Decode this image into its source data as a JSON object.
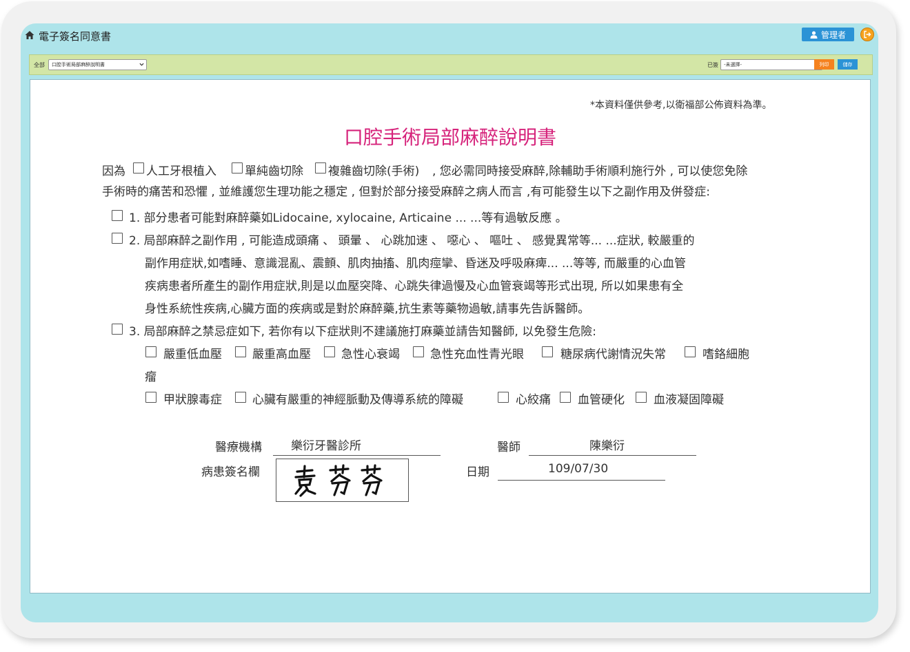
{
  "app": {
    "title": "電子簽名同意書",
    "admin_label": "管理者"
  },
  "toolbar": {
    "category_label": "全部",
    "category_value": "口腔手術局部麻醉說明書",
    "signed_label": "已簽",
    "signed_value": "-未選擇-",
    "print_label": "列印",
    "save_label": "儲存"
  },
  "document": {
    "disclaimer": "*本資料僅供參考,以衛福部公佈資料為準。",
    "title": "口腔手術局部麻醉說明書",
    "intro": {
      "prefix": "因為",
      "options": [
        "人工牙根植入",
        "單純齒切除",
        "複雜齒切除(手術)"
      ],
      "line1_rest": ", 您必需同時接受麻醉,除輔助手術順利施行外 , 可以使您免除",
      "line2": "手術時的痛苦和恐懼 , 並維護您生理功能之穩定 , 但對於部分接受麻醉之病人而言 ,有可能發生以下之副作用及併發症:"
    },
    "items": [
      {
        "lines": [
          "1. 部分患者可能對麻醉藥如Lidocaine, xylocaine, Articaine ... ...等有過敏反應 。"
        ]
      },
      {
        "lines": [
          "2. 局部麻醉之副作用 , 可能造成頭痛 、 頭暈 、 心跳加速 、 噁心 、 嘔吐 、 感覺異常等... ...症狀, 較嚴重的",
          "副作用症狀,如嗜睡、意識混亂、震顫、肌肉抽搐、肌肉痙攣、昏迷及呼吸麻痺... ...等等, 而嚴重的心血管",
          "疾病患者所產生的副作用症狀,則是以血壓突降、心跳失律過慢及心血管衰竭等形式出現, 所以如果患有全",
          "身性系統性疾病,心臟方面的疾病或是對於麻醉藥,抗生素等藥物過敏,請事先告訴醫師。"
        ]
      },
      {
        "lines": [
          "3. 局部麻醉之禁忌症如下, 若你有以下症狀則不建議施打麻藥並請告知醫師, 以免發生危險:"
        ]
      }
    ],
    "contraindications": [
      "嚴重低血壓",
      "嚴重高血壓",
      "急性心衰竭",
      "急性充血性青光眼",
      "糖尿病代謝情況失常",
      "嗜鉻細胞",
      "甲狀腺毒症",
      "心臟有嚴重的神經脈動及傳導系統的障礙",
      "心絞痛",
      "血管硬化",
      "血液凝固障礙"
    ],
    "contra_wrap": "瘤",
    "signature": {
      "institution_label": "醫療機構",
      "institution_value": "樂衍牙醫診所",
      "doctor_label": "醫師",
      "doctor_value": "陳樂衍",
      "patient_sign_label": "病患簽名欄",
      "patient_sign_text": "袁芬芬",
      "date_label": "日期",
      "date_value": "109/07/30"
    }
  }
}
